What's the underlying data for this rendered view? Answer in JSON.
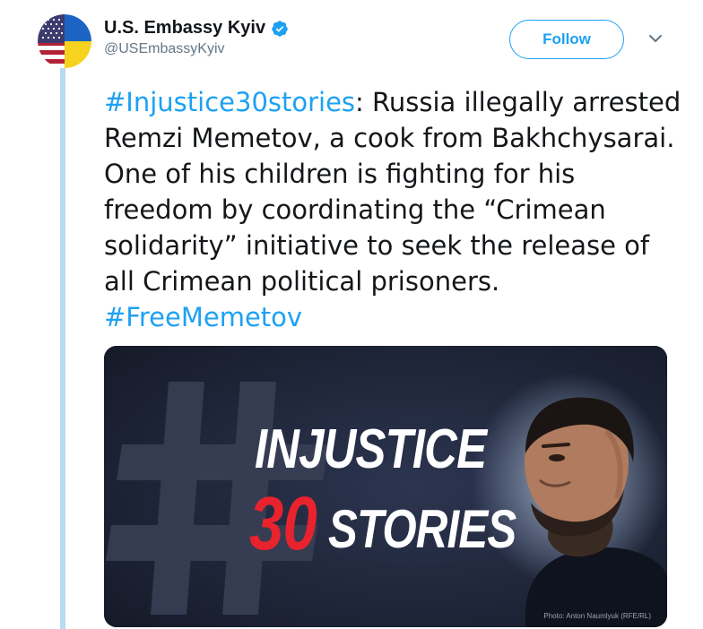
{
  "account": {
    "display_name": "U.S. Embassy Kyiv",
    "handle": "@USEmbassyKyiv",
    "verified": true
  },
  "actions": {
    "follow_label": "Follow"
  },
  "tweet": {
    "hashtag_1": "#Injustice30stories",
    "body": ": Russia illegally arrested Remzi Memetov, a cook from Bakhchysarai. One of his children is fighting for his freedom by coordinating the “Crimean solidarity” initiative to seek the release of all Crimean political prisoners. ",
    "hashtag_2": "#FreeMemetov"
  },
  "media": {
    "title_line_1": "INJUSTICE",
    "title_number": "30",
    "title_word": "STORIES",
    "photo_credit": "Photo: Anton Naumlyuk (RFE/RL)"
  },
  "colors": {
    "link": "#1da1f2",
    "thread_line": "#b7dbf2",
    "title_red": "#e8232d",
    "media_background": "#1b2133"
  },
  "icons": {
    "avatar": "us-ukraine-flag-avatar",
    "verified": "verified-badge-icon",
    "caret": "chevron-down-icon"
  }
}
